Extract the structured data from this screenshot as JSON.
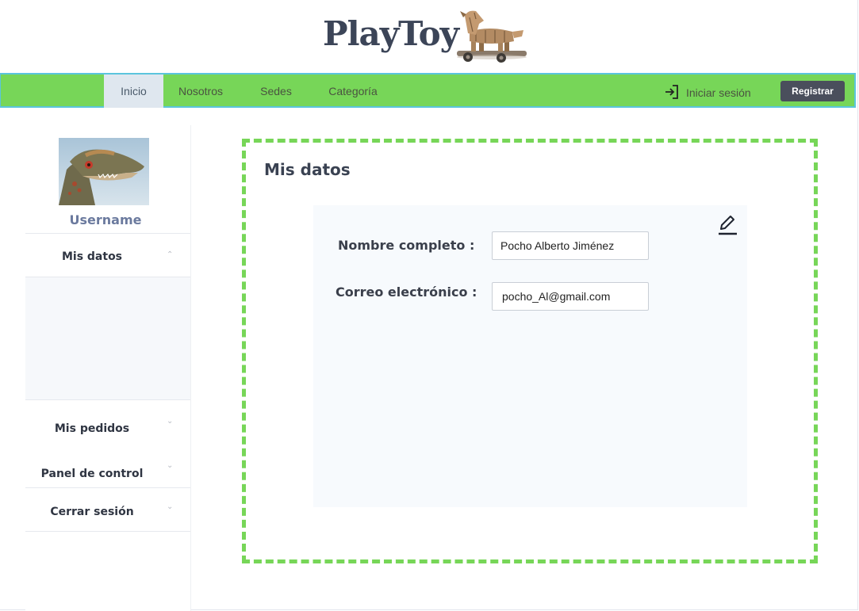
{
  "brand": {
    "title": "PlayToy",
    "logo": "wooden-horse-logo"
  },
  "nav": {
    "items": [
      {
        "label": "Inicio",
        "active": true
      },
      {
        "label": "Nosotros",
        "active": false
      },
      {
        "label": "Sedes",
        "active": false
      },
      {
        "label": "Categoría",
        "active": false
      }
    ],
    "login_label": "Iniciar sesión",
    "login_icon": "login-icon",
    "register_label": "Registrar"
  },
  "sidebar": {
    "username": "Username",
    "avatar": "dinosaur-avatar",
    "items": [
      {
        "label": "Mis datos",
        "chevron": "chevron-up",
        "expanded": true
      },
      {
        "label": "Mis pedidos",
        "chevron": "chevron-down"
      },
      {
        "label": "Panel de control",
        "chevron": "chevron-down"
      },
      {
        "label": "Cerrar sesión",
        "chevron": "chevron-down"
      }
    ]
  },
  "main": {
    "title": "Mis datos",
    "edit_icon": "pencil-icon",
    "fields": [
      {
        "label": "Nombre completo :",
        "value": "Pocho Alberto Jiménez"
      },
      {
        "label": "Correo electrónico :",
        "value": "pocho_Al@gmail.com"
      }
    ]
  },
  "colors": {
    "navbar": "#77d658",
    "navbar_border": "#5bc5dd",
    "dashed_frame": "#77d658",
    "register_button": "#4a4f5c",
    "active_tab": "#dfe7ef"
  }
}
